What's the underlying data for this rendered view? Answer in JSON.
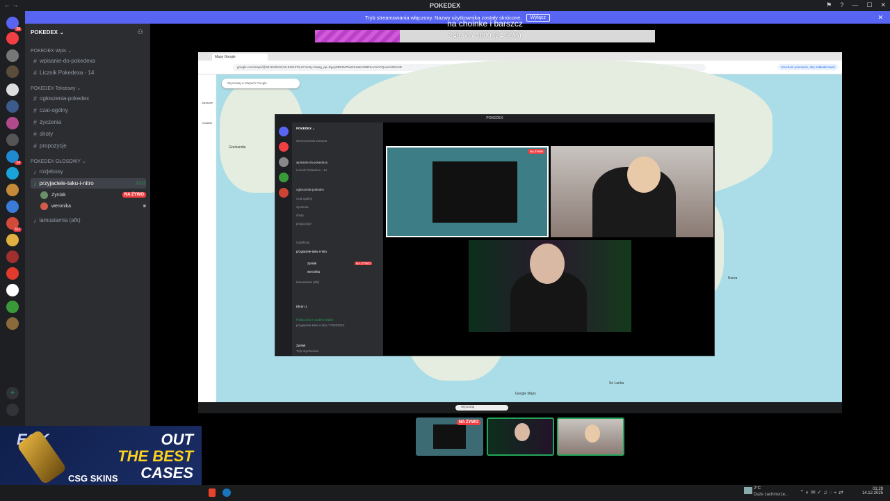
{
  "window": {
    "title": "POKEDEX",
    "back": "←",
    "forward": "→"
  },
  "banner": {
    "text": "Tryb streamowania włączony. Nazwy użytkownika zostały skrócone.",
    "button": "Wyłącz",
    "close": "✕"
  },
  "guild_badges": [
    "38",
    "24",
    "311"
  ],
  "server": {
    "name": "POKEDEX ⌄"
  },
  "categories": [
    {
      "label": "POKEDEX Wpis ⌄",
      "channels": [
        "wpisanie-do-pokedexa",
        "Licznik Pokedexa - 14"
      ]
    },
    {
      "label": "POKEDEX Tekstowy ⌄",
      "channels": [
        "ogłoszenia-pokedex",
        "czat-ogólny",
        "życzenia",
        "shoty",
        "propozycje"
      ]
    },
    {
      "label": "POKEDEX GŁOSOWY ⌄",
      "channels": [
        "rozjebusy"
      ]
    }
  ],
  "voice_active": {
    "name": "przyjaciele-taku-i-nitro",
    "time": "12:11"
  },
  "voice_users": [
    {
      "name": "Zynlak",
      "live": "NA ŻYWO"
    },
    {
      "name": "weronika",
      "live": ""
    }
  ],
  "afk_channel": "lamusiarnia (afk)",
  "progress": {
    "caption": "na choinke i barszcz",
    "text": "249.60 / 1000 (24.96%)",
    "fraction": 0.2496
  },
  "browser": {
    "tab": "Mapy Google",
    "url": "google.com/maps/@49.9346103,52.5124273,4z?entry=ttu&g_ep=EgoyMDI1MTIwOS4wIKXMDSoASAFQAw%3D%3D",
    "resume_button": "Uruchom ponownie, aby zaktualizować",
    "search_placeholder": "Wyszukaj w Mapach Google",
    "rail": [
      "Zapisane",
      "Ostatnie"
    ],
    "map_labels": [
      "Grenlandia",
      "Korea",
      "Sri Lanka",
      "Google Maps"
    ]
  },
  "inner": {
    "title": "POKEDEX",
    "server": "POKEDEX ⌄",
    "events": "Wzmocnienia serwera",
    "channels": [
      "wpisanie-do-pokedexa",
      "Licznik Pokedexa - 14",
      "ogłoszenia-pokedex",
      "czat-ogólny",
      "życzenia",
      "shoty",
      "propozycje",
      "rozjebusy",
      "przyjaciele-taku-i-nitro"
    ],
    "users": [
      "Zynlak",
      "weronika"
    ],
    "afk": "lamusiarnia (afk)",
    "live": "NA ŻYWO",
    "screen_label": "Ekran 1",
    "connected": "Połączono z czatem wideo",
    "connected_sub": "przyjaciele-taku-i-nitro / POKEDEX",
    "me": "Zynlak",
    "me_status": "Tryb wyciszenia"
  },
  "search_taskbar": "Wyszukaj",
  "ad": {
    "line1": "ECK",
    "line1b": "OUT",
    "line2": "THE BEST",
    "line3": "CASES",
    "brand": "CSG SKINS"
  },
  "clock": {
    "time": "01:29",
    "date": "14.12.2025"
  },
  "weather": {
    "temp": "2°C",
    "desc": "Duże zachmurze..."
  },
  "colors": {
    "discord_bg": "#2b2d31",
    "blurple": "#5865f2",
    "live_red": "#f23f43",
    "progress_fill": "#c94fd2"
  }
}
